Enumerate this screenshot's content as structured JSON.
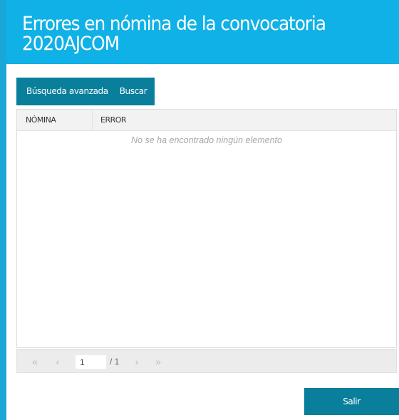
{
  "header": {
    "title_line1": "Errores en nómina de la convocatoria",
    "title_line2": "2020AJCOM"
  },
  "toolbar": {
    "advanced_search_label": "Búsqueda avanzada",
    "search_label": "Buscar"
  },
  "grid": {
    "columns": [
      "NÓMINA",
      "ERROR"
    ],
    "rows": [],
    "empty_message": "No se ha encontrado ningún elemento"
  },
  "pager": {
    "first_icon": "double-chevron-left-icon",
    "prev_icon": "chevron-left-icon",
    "next_icon": "chevron-right-icon",
    "last_icon": "double-chevron-right-icon",
    "current_page": "1",
    "total_pages_label": "/ 1"
  },
  "footer": {
    "exit_label": "Salir"
  },
  "colors": {
    "header_bg": "#10b1e6",
    "accent_dark": "#0a7f9c",
    "left_accent": "#1aa7d8"
  }
}
